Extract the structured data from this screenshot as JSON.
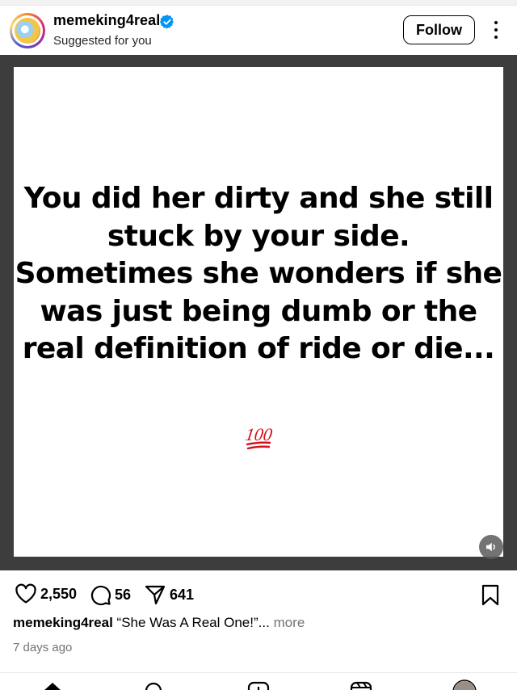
{
  "post": {
    "username": "memeking4real",
    "subtitle": "Suggested for you",
    "follow_label": "Follow",
    "quote": "You did her dirty and she still stuck by your side. Sometimes she wonders if she was just being dumb or the real definition of ride or die...",
    "emoji": "100"
  },
  "actions": {
    "likes": "2,550",
    "comments": "56",
    "shares": "641"
  },
  "caption": {
    "username": "memeking4real",
    "text": "“She Was A Real One!”",
    "ellipsis": "...",
    "more": "more"
  },
  "timestamp": "7 days ago",
  "colors": {
    "verified": "#0095f6",
    "media_background": "#3d3d3d",
    "emoji_red": "#d0101e",
    "muted_text": "#737373"
  },
  "icons": [
    "verified-badge-icon",
    "more-options-icon",
    "sound-icon",
    "heart-icon",
    "comment-icon",
    "share-icon",
    "bookmark-icon",
    "home-icon",
    "search-icon",
    "create-icon",
    "reels-icon",
    "profile-icon"
  ]
}
